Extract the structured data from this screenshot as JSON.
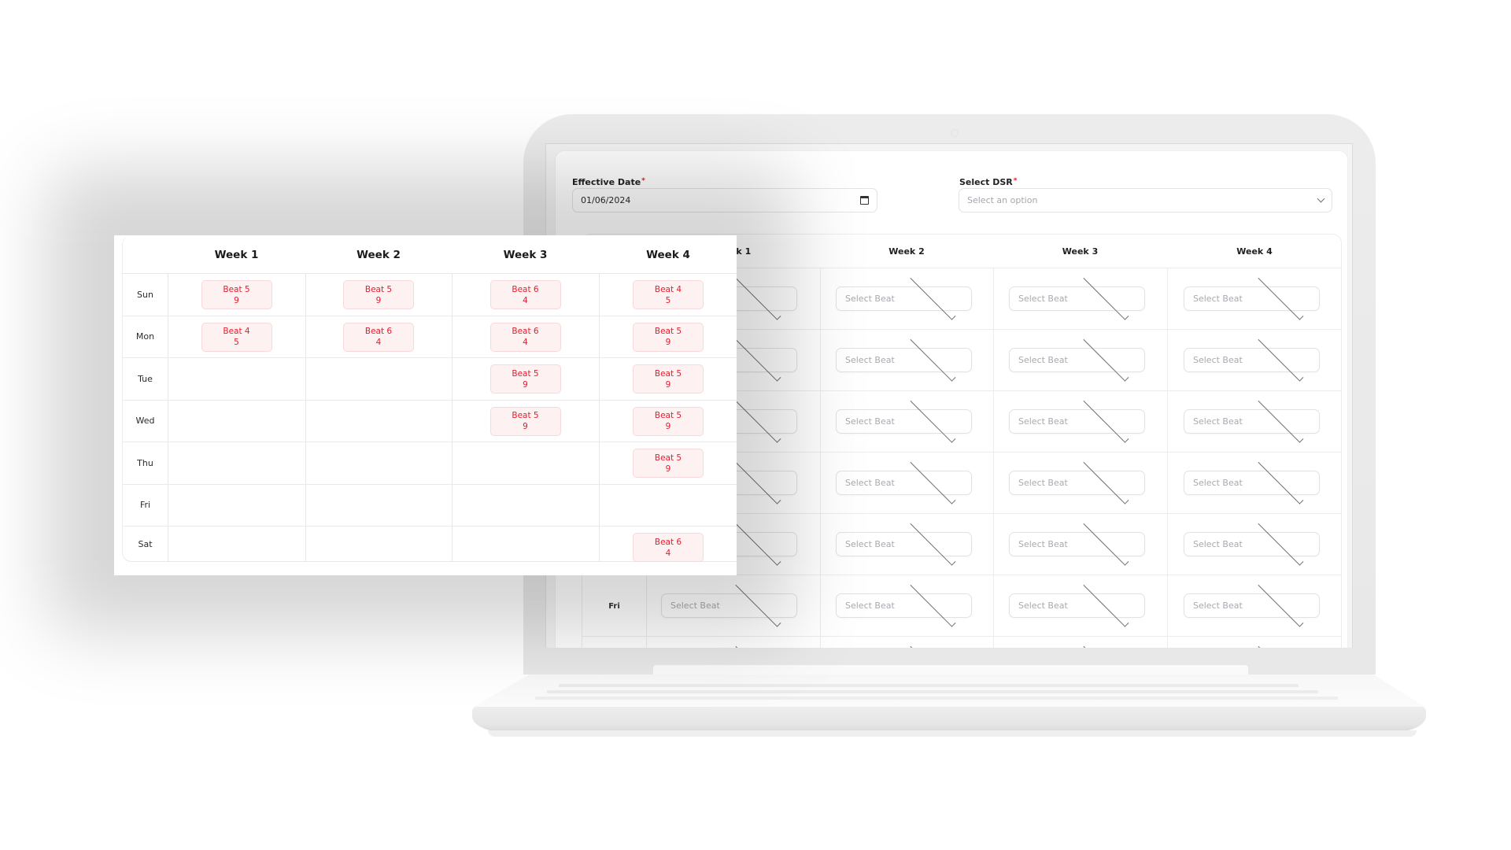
{
  "form": {
    "effective_date": {
      "label": "Effective Date",
      "required_mark": "*",
      "value": "01/06/2024"
    },
    "select_dsr": {
      "label": "Select DSR",
      "required_mark": "*",
      "placeholder": "Select an option"
    }
  },
  "screen_table": {
    "headers": [
      "",
      "Week 1",
      "Week 2",
      "Week 3",
      "Week 4"
    ],
    "days": [
      "Sun",
      "Mon",
      "Tue",
      "Wed",
      "Thu",
      "Fri",
      "Sat"
    ],
    "select_placeholder": "Select Beat"
  },
  "schedule": {
    "headers": [
      "Week 1",
      "Week 2",
      "Week 3",
      "Week 4"
    ],
    "rows": [
      {
        "day": "Sun",
        "cells": [
          {
            "beat": "Beat 5",
            "count": "9"
          },
          {
            "beat": "Beat 5",
            "count": "9"
          },
          {
            "beat": "Beat 6",
            "count": "4"
          },
          {
            "beat": "Beat 4",
            "count": "5"
          }
        ]
      },
      {
        "day": "Mon",
        "cells": [
          {
            "beat": "Beat 4",
            "count": "5"
          },
          {
            "beat": "Beat 6",
            "count": "4"
          },
          {
            "beat": "Beat 6",
            "count": "4"
          },
          {
            "beat": "Beat 5",
            "count": "9"
          }
        ]
      },
      {
        "day": "Tue",
        "cells": [
          null,
          null,
          {
            "beat": "Beat 5",
            "count": "9"
          },
          {
            "beat": "Beat 5",
            "count": "9"
          }
        ]
      },
      {
        "day": "Wed",
        "cells": [
          null,
          null,
          {
            "beat": "Beat 5",
            "count": "9"
          },
          {
            "beat": "Beat 5",
            "count": "9"
          }
        ]
      },
      {
        "day": "Thu",
        "cells": [
          null,
          null,
          null,
          {
            "beat": "Beat 5",
            "count": "9"
          }
        ]
      },
      {
        "day": "Fri",
        "cells": [
          null,
          null,
          null,
          null
        ]
      },
      {
        "day": "Sat",
        "cells": [
          null,
          null,
          null,
          {
            "beat": "Beat 6",
            "count": "4"
          }
        ]
      }
    ]
  },
  "icons": {
    "date": "calendar-icon",
    "select": "chevron-down-icon"
  },
  "colors": {
    "accent_red": "#e0202f",
    "chip_bg": "#fdf1f1",
    "chip_border": "#f8d9db"
  }
}
